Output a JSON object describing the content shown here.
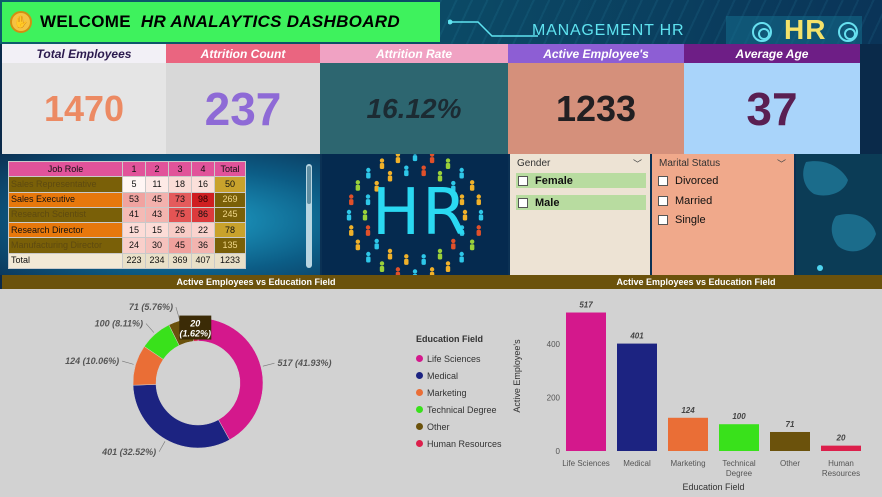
{
  "header": {
    "welcome_label": "WELCOME",
    "dashboard_title": "HR ANALAYTICS DASHBOARD",
    "management_label": "MANAGEMENT HR",
    "logo_text": "HR"
  },
  "kpis": [
    {
      "label": "Total Employees",
      "value": "1470",
      "head_bg": "#f2f0f6",
      "head_fg": "#2b1a4e",
      "body_bg": "#e5e5e5",
      "value_fg": "#ec8a63",
      "size": 36
    },
    {
      "label": "Attrition Count",
      "value": "237",
      "head_bg": "#ea6580",
      "head_fg": "#ffffff",
      "body_bg": "#d8d8d8",
      "value_fg": "#8e6ad6",
      "size": 46
    },
    {
      "label": "Attrition Rate",
      "value": "16.12%",
      "head_bg": "#f0a2c3",
      "head_fg": "#ffffff",
      "body_bg": "#2d6670",
      "value_fg": "#1c2b33",
      "size": 28
    },
    {
      "label": "Active Employee's",
      "value": "1233",
      "head_bg": "#8d5ed4",
      "head_fg": "#ffffff",
      "body_bg": "#d5907b",
      "value_fg": "#221f22",
      "size": 36
    },
    {
      "label": "Average Age",
      "value": "37",
      "head_bg": "#6e1e86",
      "head_fg": "#ffffff",
      "body_bg": "#a9d4fa",
      "value_fg": "#5a1f52",
      "size": 46
    }
  ],
  "job_role_table": {
    "headers": [
      "Job Role",
      "1",
      "2",
      "3",
      "4",
      "Total"
    ],
    "rows": [
      {
        "role": "Sales Representative",
        "values": [
          "5",
          "11",
          "18",
          "16"
        ],
        "total": "50",
        "shade": "dark"
      },
      {
        "role": "Sales Executive",
        "values": [
          "53",
          "45",
          "73",
          "98"
        ],
        "total": "269",
        "shade": "orange"
      },
      {
        "role": "Research Scientist",
        "values": [
          "41",
          "43",
          "75",
          "86"
        ],
        "total": "245",
        "shade": "dark"
      },
      {
        "role": "Research Director",
        "values": [
          "15",
          "15",
          "26",
          "22"
        ],
        "total": "78",
        "shade": "orange"
      },
      {
        "role": "Manufacturing Director",
        "values": [
          "24",
          "30",
          "45",
          "36"
        ],
        "total": "135",
        "shade": "dark"
      }
    ],
    "total_row": {
      "label": "Total",
      "values": [
        "223",
        "234",
        "369",
        "407"
      ],
      "total": "1233"
    }
  },
  "center_logo": "HR",
  "slicers": {
    "gender": {
      "title": "Gender",
      "options": [
        "Female",
        "Male"
      ]
    },
    "marital": {
      "title": "Marital Status",
      "options": [
        "Divorced",
        "Married",
        "Single"
      ]
    }
  },
  "section_titles": {
    "left": "Active Employees vs Education Field",
    "right": "Active Employees vs Education Field"
  },
  "colors": {
    "Life Sciences": "#d4188c",
    "Medical": "#1c2381",
    "Marketing": "#ea6e36",
    "Technical Degree": "#39e11b",
    "Other": "#6b520c",
    "Human Resources": "#dc1f4b"
  },
  "chart_data": [
    {
      "type": "pie",
      "title": "Active Employees vs Education Field",
      "legend_title": "Education Field",
      "legend_placement": "right",
      "slices": [
        {
          "label": "Life Sciences",
          "value": 517,
          "pct": "41.93%"
        },
        {
          "label": "Medical",
          "value": 401,
          "pct": "32.52%"
        },
        {
          "label": "Marketing",
          "value": 124,
          "pct": "10.06%"
        },
        {
          "label": "Technical Degree",
          "value": 100,
          "pct": "8.11%"
        },
        {
          "label": "Other",
          "value": 71,
          "pct": "5.76%"
        },
        {
          "label": "Human Resources",
          "value": 20,
          "pct": "1.62%"
        }
      ]
    },
    {
      "type": "bar",
      "title": "Active Employees vs Education Field",
      "categories": [
        "Life Sciences",
        "Medical",
        "Marketing",
        "Technical Degree",
        "Other",
        "Human Resources"
      ],
      "tick_labels": [
        [
          "Life Sciences"
        ],
        [
          "Medical"
        ],
        [
          "Marketing"
        ],
        [
          "Technical",
          "Degree"
        ],
        [
          "Other"
        ],
        [
          "Human",
          "Resources"
        ]
      ],
      "values": [
        517,
        401,
        124,
        100,
        71,
        20
      ],
      "xlabel": "Education Field",
      "ylabel": "Active Employee's",
      "yticks": [
        0,
        200,
        400
      ],
      "ylim": [
        0,
        560
      ],
      "grid": false
    }
  ]
}
